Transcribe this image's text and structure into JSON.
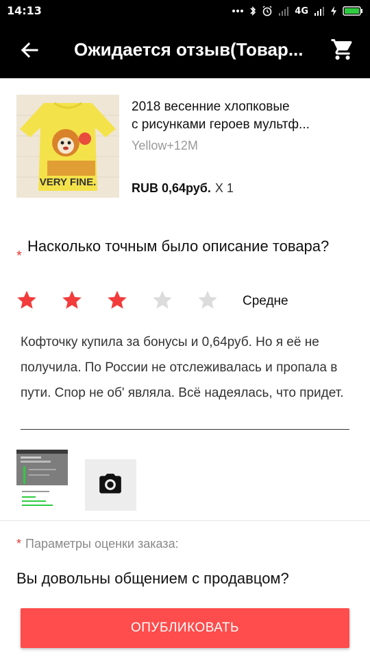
{
  "status_bar": {
    "time": "14:13",
    "network": "4G",
    "icons": [
      "dots-icon",
      "bluetooth-icon",
      "alarm-icon",
      "signal-icon",
      "network-4g",
      "signal-icon",
      "charging-icon",
      "battery-icon"
    ]
  },
  "app_bar": {
    "title": "Ожидается отзыв(Товар...",
    "back_icon": "arrow-back-icon",
    "cart_icon": "cart-icon"
  },
  "product": {
    "title_line1": "2018 весенние хлопковые",
    "title_line2": "с рисунками героев мультф...",
    "variant": "Yellow+12M",
    "price": "RUB 0,64руб.",
    "quantity": "X 1",
    "image_text": "VERY FINE."
  },
  "rating": {
    "required_mark": "*",
    "question": "Насколько точным было описание товара?",
    "value": 3,
    "max": 5,
    "label": "Средне",
    "colors": {
      "active": "#f23c3c",
      "inactive": "#dcdcdc"
    }
  },
  "review": {
    "text": "Кофточку купила за бонусы и 0,64руб. Но я её не получила. По России не отслеживалась и пропала в пути. Спор не об' являла. Всё надеялась, что придет."
  },
  "photos": {
    "add_photo_icon": "camera-icon"
  },
  "params": {
    "required_mark": "*",
    "label": "Параметры оценки заказа:"
  },
  "seller_question": "Вы довольны общением с продавцом?",
  "publish_button": "ОПУБЛИКОВАТЬ"
}
